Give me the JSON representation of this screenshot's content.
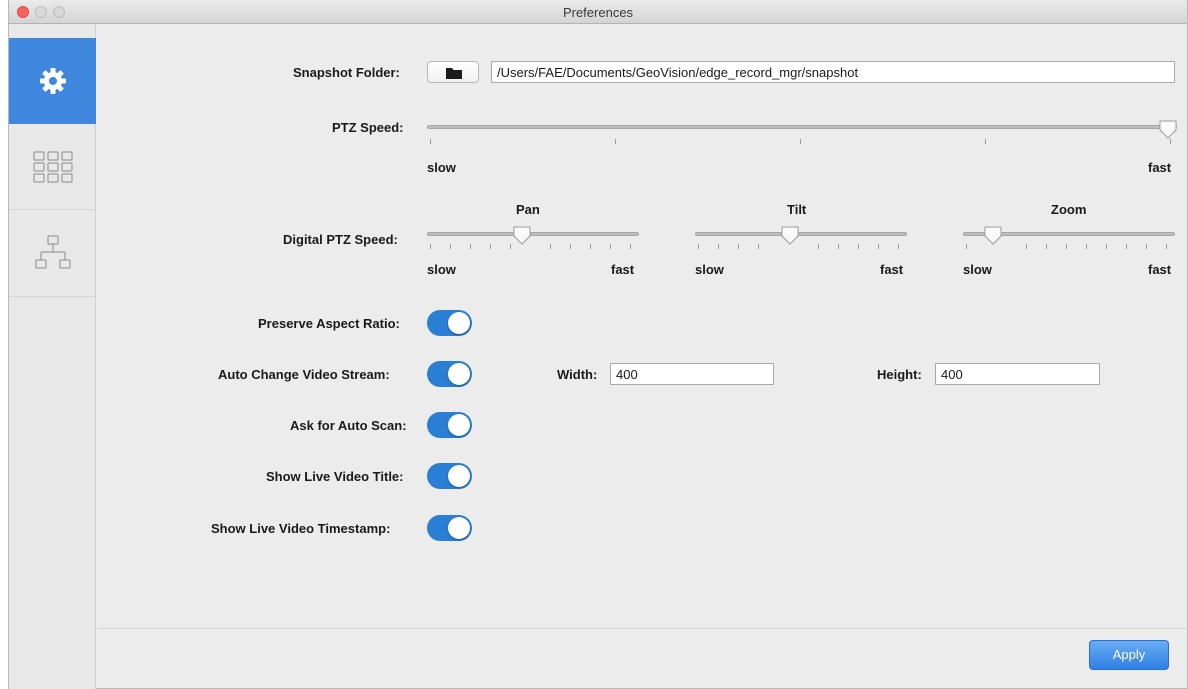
{
  "window": {
    "title": "Preferences"
  },
  "sidebar": {
    "items": [
      {
        "icon": "gear-icon",
        "active": true
      },
      {
        "icon": "grid-icon",
        "active": false
      },
      {
        "icon": "network-tree-icon",
        "active": false
      }
    ]
  },
  "snapshot": {
    "label": "Snapshot Folder:",
    "path": "/Users/FAE/Documents/GeoVision/edge_record_mgr/snapshot"
  },
  "ptz": {
    "label": "PTZ Speed:",
    "slow": "slow",
    "fast": "fast",
    "value": 1.0
  },
  "digital_ptz": {
    "label": "Digital PTZ Speed:",
    "sliders": [
      {
        "title": "Pan",
        "slow": "slow",
        "fast": "fast",
        "value": 0.45
      },
      {
        "title": "Tilt",
        "slow": "slow",
        "fast": "fast",
        "value": 0.45
      },
      {
        "title": "Zoom",
        "slow": "slow",
        "fast": "fast",
        "value": 0.15
      }
    ]
  },
  "toggles": [
    {
      "label": "Preserve Aspect Ratio:",
      "on": true
    },
    {
      "label": "Auto Change Video Stream:",
      "on": true
    },
    {
      "label": "Ask for Auto Scan:",
      "on": true
    },
    {
      "label": "Show Live Video Title:",
      "on": true
    },
    {
      "label": "Show Live Video Timestamp:",
      "on": true
    }
  ],
  "stream": {
    "width_label": "Width:",
    "width_value": "400",
    "height_label": "Height:",
    "height_value": "400"
  },
  "footer": {
    "apply_label": "Apply"
  },
  "colors": {
    "accent": "#3f86df",
    "toggle_on": "#2a7fd4"
  }
}
